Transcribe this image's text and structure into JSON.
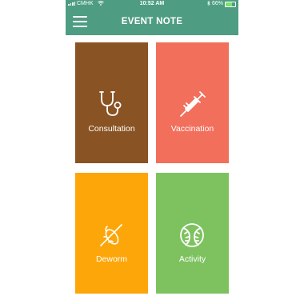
{
  "status_bar": {
    "carrier": "CMHK",
    "time": "10:52 AM",
    "battery": "66%",
    "battery_level": 0.66,
    "battery_color": "#7be36b"
  },
  "app_bar": {
    "title": "EVENT NOTE",
    "menu_icon": "hamburger-menu-icon",
    "color": "#4e9d82"
  },
  "tiles": [
    {
      "label": "Consultation",
      "icon": "stethoscope-icon",
      "color": "#8a5323"
    },
    {
      "label": "Vaccination",
      "icon": "syringe-icon",
      "color": "#f26f5c"
    },
    {
      "label": "Deworm",
      "icon": "no-bug-icon",
      "color": "#fda60a"
    },
    {
      "label": "Activity",
      "icon": "ball-icon",
      "color": "#7ec260"
    }
  ]
}
